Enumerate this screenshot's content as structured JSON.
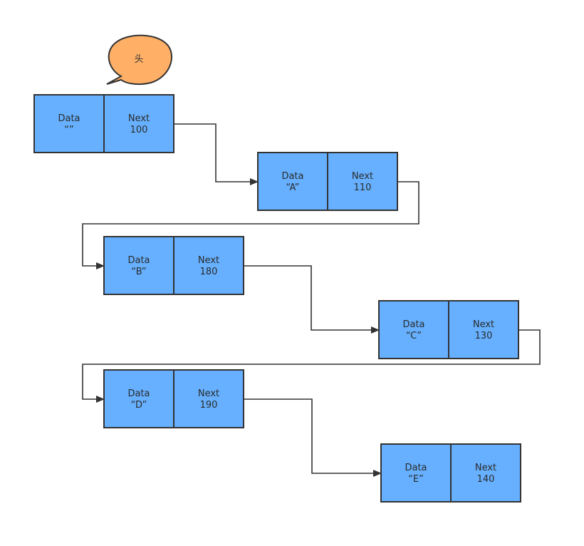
{
  "diagram": {
    "type": "linked-list",
    "colors": {
      "node_fill": "#66b0ff",
      "node_stroke": "#333333",
      "bubble_fill": "#ffb066",
      "bubble_stroke": "#333333",
      "edge": "#333333"
    },
    "head_label": "头",
    "nodes": [
      {
        "id": "n0",
        "data_label": "Data",
        "data_value": "“”",
        "next_label": "Next",
        "next_value": "100"
      },
      {
        "id": "n1",
        "data_label": "Data",
        "data_value": "“A”",
        "next_label": "Next",
        "next_value": "110"
      },
      {
        "id": "n2",
        "data_label": "Data",
        "data_value": "“B”",
        "next_label": "Next",
        "next_value": "180"
      },
      {
        "id": "n3",
        "data_label": "Data",
        "data_value": "“C”",
        "next_label": "Next",
        "next_value": "130"
      },
      {
        "id": "n4",
        "data_label": "Data",
        "data_value": "“D”",
        "next_label": "Next",
        "next_value": "190"
      },
      {
        "id": "n5",
        "data_label": "Data",
        "data_value": "“E”",
        "next_label": "Next",
        "next_value": "140"
      }
    ],
    "edges": [
      {
        "from": "n0",
        "to": "n1"
      },
      {
        "from": "n1",
        "to": "n2"
      },
      {
        "from": "n2",
        "to": "n3"
      },
      {
        "from": "n3",
        "to": "n4"
      },
      {
        "from": "n4",
        "to": "n5"
      }
    ]
  }
}
